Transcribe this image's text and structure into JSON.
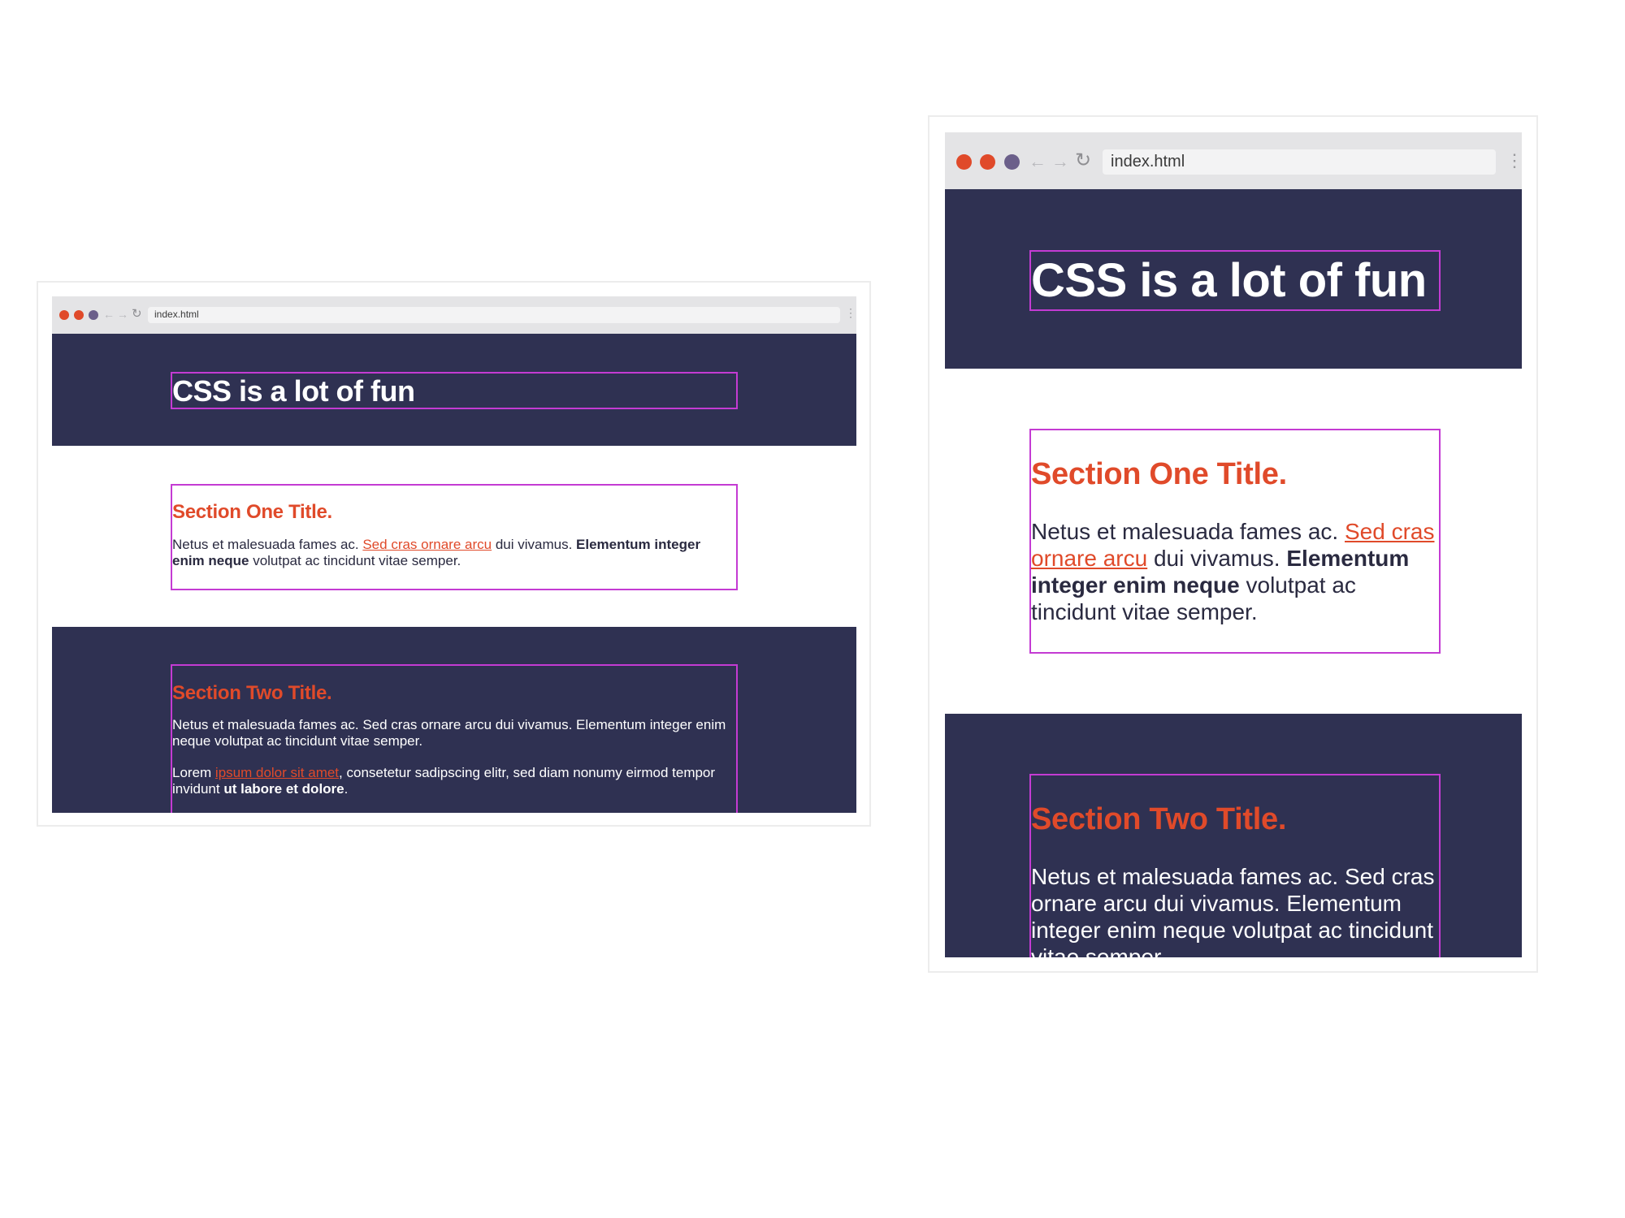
{
  "browser": {
    "url": "index.html",
    "dot_colors": [
      "#e04a2a",
      "#e04a2a",
      "#6b5f8a"
    ],
    "icons": [
      "back-arrow-icon",
      "forward-arrow-icon",
      "reload-icon",
      "more-menu-icon"
    ]
  },
  "colors": {
    "header_bg": "#2f3152",
    "accent": "#e04a2a",
    "outline": "#c43bd3"
  },
  "page": {
    "header_title": "CSS is a lot of fun",
    "section_one": {
      "title": "Section One Title.",
      "p1_text_a": "Netus et malesuada fames ac. ",
      "p1_link": "Sed cras ornare arcu",
      "p1_text_b": " dui vivamus. ",
      "p1_bold": "Elementum integer enim neque",
      "p1_text_c": " volutpat ac tincidunt vitae semper."
    },
    "section_two": {
      "title": "Section Two Title.",
      "p1": "Netus et malesuada fames ac. Sed cras ornare arcu dui vivamus. Elementum integer enim neque volutpat ac tincidunt vitae semper.",
      "p2_text_a": "Lorem ",
      "p2_link": "ipsum dolor sit amet",
      "p2_text_b": ", consetetur sadipscing elitr, sed diam nonumy eirmod tempor invidunt ",
      "p2_bold": "ut labore et dolore",
      "p2_text_c": "."
    }
  }
}
